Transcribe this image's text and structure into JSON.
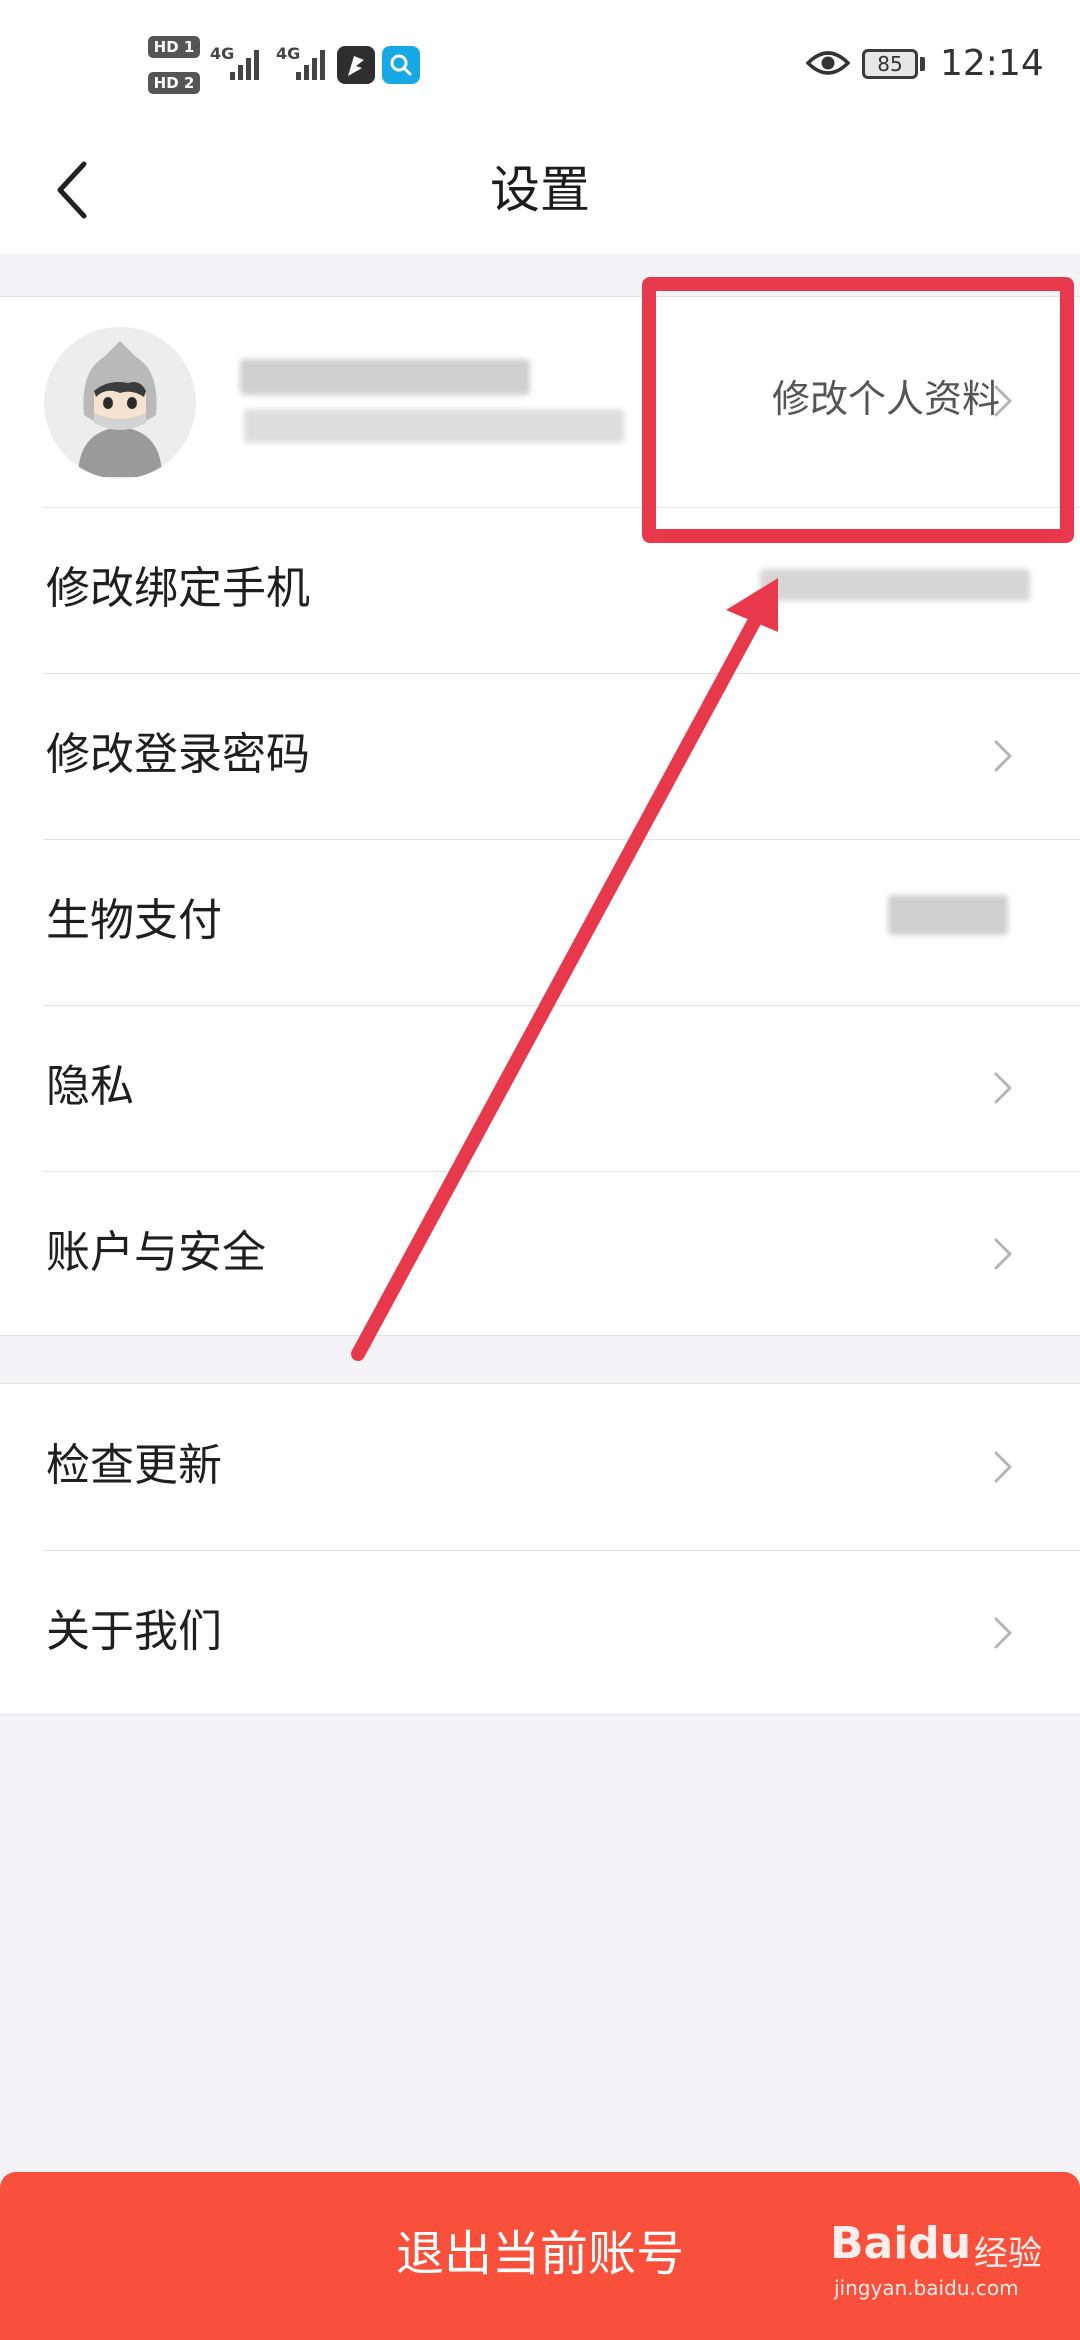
{
  "status_bar": {
    "sim1_badge": "HD 1",
    "sim2_badge": "HD 2",
    "network1": "4G",
    "network2": "4G",
    "battery_level": "85",
    "time": "12:14",
    "icons": [
      "signal-bars-icon",
      "feather-app-icon",
      "search-app-icon",
      "eye-icon",
      "battery-icon"
    ]
  },
  "header": {
    "title": "设置",
    "back_icon": "chevron-left-icon"
  },
  "profile": {
    "edit_label": "修改个人资料"
  },
  "group1": {
    "items": [
      {
        "label": "修改绑定手机"
      },
      {
        "label": "修改登录密码"
      },
      {
        "label": "生物支付"
      },
      {
        "label": "隐私"
      },
      {
        "label": "账户与安全"
      }
    ]
  },
  "group2": {
    "items": [
      {
        "label": "检查更新"
      },
      {
        "label": "关于我们"
      }
    ]
  },
  "logout": {
    "label": "退出当前账号"
  },
  "watermark": {
    "brand": "Baidu",
    "suffix": "经验",
    "domain": "jingyan.baidu.com"
  },
  "colors": {
    "accent": "#f9503b",
    "annotation": "#e8394c",
    "background": "#f4f4f6",
    "surface": "#ffffff",
    "chevron": "#b5b5b5"
  }
}
